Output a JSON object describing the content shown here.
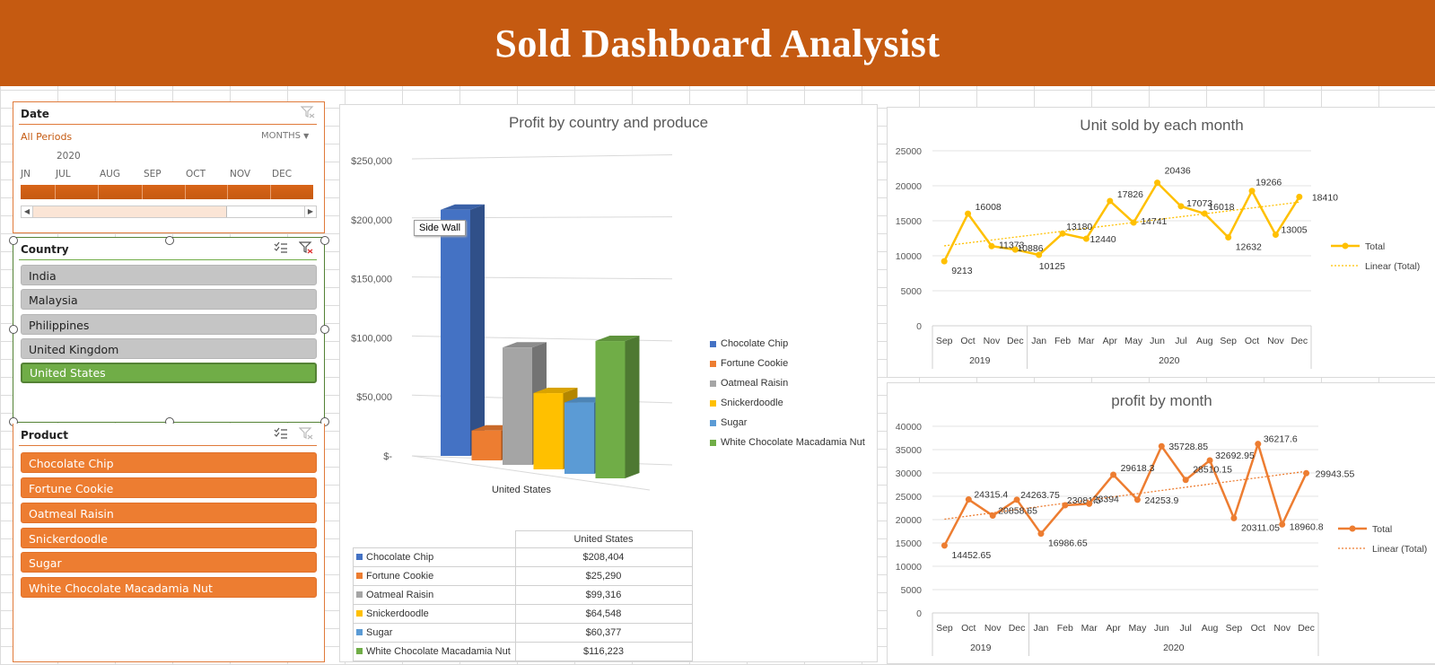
{
  "header": {
    "title": "Sold Dashboard Analysist"
  },
  "date_slicer": {
    "title": "Date",
    "period_label": "All Periods",
    "level": "MONTHS",
    "year": "2020",
    "months": [
      "JN",
      "JUL",
      "AUG",
      "SEP",
      "OCT",
      "NOV",
      "DEC"
    ]
  },
  "country_slicer": {
    "title": "Country",
    "items": [
      {
        "label": "India",
        "selected": false
      },
      {
        "label": "Malaysia",
        "selected": false
      },
      {
        "label": "Philippines",
        "selected": false
      },
      {
        "label": "United Kingdom",
        "selected": false
      },
      {
        "label": "United States",
        "selected": true
      }
    ]
  },
  "product_slicer": {
    "title": "Product",
    "items": [
      "Chocolate Chip",
      "Fortune Cookie",
      "Oatmeal Raisin",
      "Snickerdoodle",
      "Sugar",
      "White Chocolate Macadamia Nut"
    ]
  },
  "icons": {
    "filter_clear": "filter-clear-icon",
    "multi_select": "multi-select-icon"
  },
  "chart_data": [
    {
      "type": "bar",
      "title": "Profit by country and produce",
      "categories": [
        "United States"
      ],
      "xlabel": "United States",
      "yticks": [
        "$250,000",
        "$200,000",
        "$150,000",
        "$100,000",
        "$50,000",
        "$-"
      ],
      "ylim": [
        0,
        250000
      ],
      "tooltip": "Side Wall",
      "series": [
        {
          "name": "Chocolate Chip",
          "values": [
            208404
          ],
          "color": "#4472c4"
        },
        {
          "name": "Fortune Cookie",
          "values": [
            25290
          ],
          "color": "#ed7d31"
        },
        {
          "name": "Oatmeal Raisin",
          "values": [
            99316
          ],
          "color": "#a5a5a5"
        },
        {
          "name": "Snickerdoodle",
          "values": [
            64548
          ],
          "color": "#ffc000"
        },
        {
          "name": "Sugar",
          "values": [
            60377
          ],
          "color": "#5b9bd5"
        },
        {
          "name": "White Chocolate Macadamia Nut",
          "values": [
            116223
          ],
          "color": "#70ad47"
        }
      ],
      "table": {
        "column_header": "United States",
        "rows": [
          {
            "label": "Chocolate Chip",
            "value": "$208,404"
          },
          {
            "label": "Fortune Cookie",
            "value": "$25,290"
          },
          {
            "label": "Oatmeal Raisin",
            "value": "$99,316"
          },
          {
            "label": "Snickerdoodle",
            "value": "$64,548"
          },
          {
            "label": "Sugar",
            "value": "$60,377"
          },
          {
            "label": "White Chocolate Macadamia Nut",
            "value": "$116,223"
          }
        ]
      }
    },
    {
      "type": "line",
      "title": "Unit sold by each month",
      "x": [
        "Sep",
        "Oct",
        "Nov",
        "Dec",
        "Jan",
        "Feb",
        "Mar",
        "Apr",
        "May",
        "Jun",
        "Jul",
        "Aug",
        "Sep",
        "Oct",
        "Nov",
        "Dec"
      ],
      "x_groups": [
        {
          "label": "2019",
          "count": 4
        },
        {
          "label": "2020",
          "count": 12
        }
      ],
      "ylim": [
        0,
        25000
      ],
      "yticks": [
        0,
        5000,
        10000,
        15000,
        20000,
        25000
      ],
      "series": [
        {
          "name": "Total",
          "color": "#ffc000",
          "values": [
            9213,
            16008,
            11373,
            10886,
            10125,
            13180,
            12440,
            17826,
            14741,
            20436,
            17073,
            16018,
            12632,
            19266,
            13005,
            18410
          ],
          "labels": [
            "9213",
            "16008",
            "11373",
            "10886",
            "10125",
            "13180",
            "12440",
            "17826",
            "14741",
            "20436",
            "17073",
            "16018",
            "12632",
            "19266",
            "13005",
            "18410"
          ]
        },
        {
          "name": "Linear (Total)",
          "color": "#ffc000",
          "trend": true
        }
      ],
      "legend": "right"
    },
    {
      "type": "line",
      "title": "profit by month",
      "x": [
        "Sep",
        "Oct",
        "Nov",
        "Dec",
        "Jan",
        "Feb",
        "Mar",
        "Apr",
        "May",
        "Jun",
        "Jul",
        "Aug",
        "Sep",
        "Oct",
        "Nov",
        "Dec"
      ],
      "x_groups": [
        {
          "label": "2019",
          "count": 4
        },
        {
          "label": "2020",
          "count": 12
        }
      ],
      "ylim": [
        0,
        40000
      ],
      "yticks": [
        0,
        5000,
        10000,
        15000,
        20000,
        25000,
        30000,
        35000,
        40000
      ],
      "series": [
        {
          "name": "Total",
          "color": "#ed7d31",
          "values": [
            14452.65,
            24315.4,
            20858.65,
            24263.75,
            16986.65,
            23081.5,
            23394,
            29618.3,
            24253.9,
            35728.85,
            28510.15,
            32692.95,
            20311.05,
            36217.6,
            18960.8,
            29943.55
          ],
          "labels": [
            "14452.65",
            "24315.4",
            "20858.65",
            "24263.75",
            "16986.65",
            "23081.5",
            "23394",
            "29618.3",
            "24253.9",
            "35728.85",
            "28510.15",
            "32692.95",
            "20311.05",
            "36217.6",
            "18960.8",
            "29943.55"
          ]
        },
        {
          "name": "Linear (Total)",
          "color": "#ed7d31",
          "trend": true
        }
      ],
      "legend": "right"
    }
  ]
}
